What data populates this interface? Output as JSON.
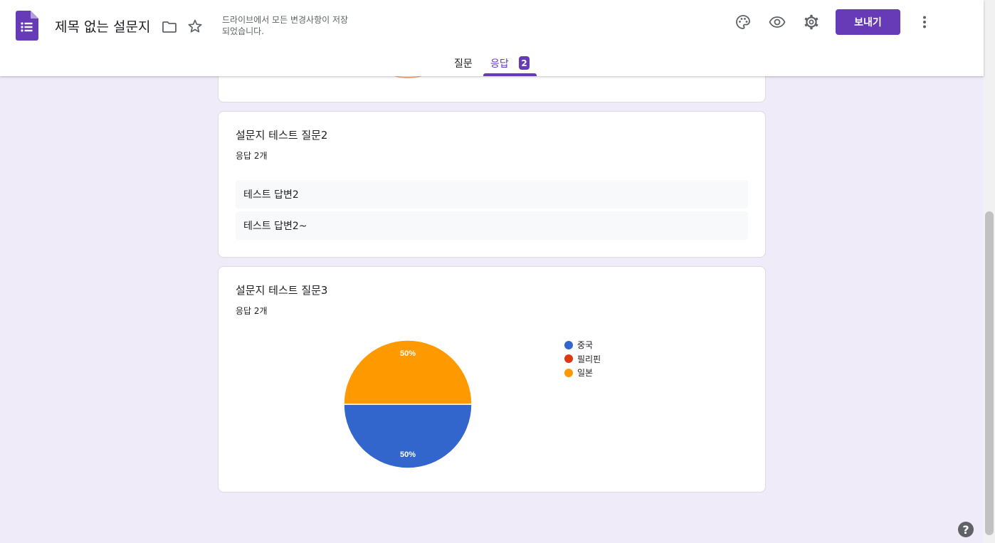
{
  "header": {
    "title": "제목 없는 설문지",
    "save_status": "드라이브에서 모든 변경사항이 저장되었습니다.",
    "send_label": "보내기",
    "icons": [
      "folder-icon",
      "star-icon",
      "palette-icon",
      "eye-icon",
      "gear-icon",
      "more-vert-icon"
    ],
    "accent_color": "#673ab7"
  },
  "tabs": {
    "questions": "질문",
    "responses": "응답",
    "responses_badge": "2"
  },
  "questions": [
    {
      "title": "설문지 테스트 질문2",
      "response_count": "응답 2개",
      "answers": [
        "테스트 답변2",
        "테스트 답변2~"
      ]
    },
    {
      "title": "설문지 테스트 질문3",
      "response_count": "응답 2개"
    }
  ],
  "chart_data": {
    "type": "pie",
    "categories": [
      "중국",
      "필리핀",
      "일본"
    ],
    "values": [
      50,
      0,
      50
    ],
    "labels": [
      "50%",
      "",
      "50%"
    ],
    "colors": [
      "#3366cc",
      "#dc3912",
      "#ff9900"
    ],
    "legend_position": "right"
  },
  "help_label": "?"
}
